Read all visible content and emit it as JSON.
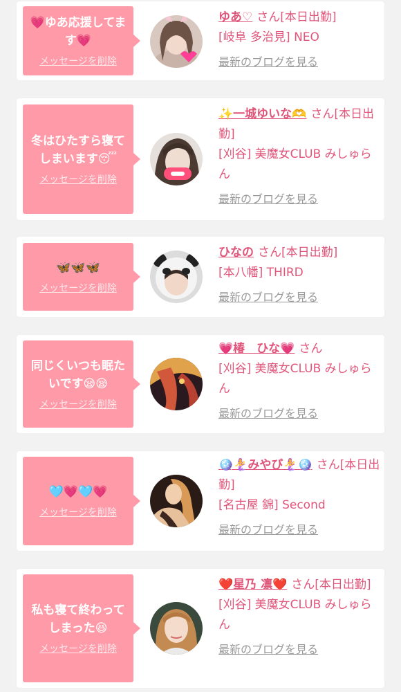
{
  "delete_label": "メッセージを削除",
  "san_label": "さん",
  "blog_label": "最新のブログを見る",
  "colors": {
    "page_bg": "#f2f2f2",
    "card_bg": "#ffffff",
    "bubble_bg": "#ff9aa8",
    "name_pink": "#e0557a",
    "link_gray": "#999999"
  },
  "cards": [
    {
      "message": "💗ゆあ応援してます💗",
      "name": "ゆあ♡",
      "status": "[本日出勤]",
      "area_shop": "[岐阜 多治見] NEO",
      "avatar_icon": "girl-photo-icon"
    },
    {
      "message": "冬はひたすら寝てしまいます😴",
      "name": "✨一城ゆいな🫶",
      "status": "[本日出勤]",
      "area_shop": "[刈谷] 美魔女CLUB みしゅらん",
      "avatar_icon": "girl-photo-icon"
    },
    {
      "message": "🦋🦋🦋",
      "name": "ひなの",
      "status": "[本日出勤]",
      "area_shop": "[本八幡] THIRD",
      "avatar_icon": "panda-hood-photo-icon"
    },
    {
      "message": "同じくいつも眠たいです😪😪",
      "name": "💗椿　ひな💗",
      "status": "",
      "area_shop": "[刈谷] 美魔女CLUB みしゅらん",
      "avatar_icon": "girl-photo-icon"
    },
    {
      "message": "🩵💗🩵💗",
      "name": "🪩🧜‍♀️みやび🧜‍♀️🪩",
      "status": "[本日出勤]",
      "area_shop": "[名古屋 錦] Second",
      "avatar_icon": "girl-photo-icon"
    },
    {
      "message": "私も寝て終わってしまった😆",
      "name": "❤️星乃 凛❤️",
      "status": "[本日出勤]",
      "area_shop": "[刈谷] 美魔女CLUB みしゅらん",
      "avatar_icon": "girl-photo-icon"
    }
  ]
}
